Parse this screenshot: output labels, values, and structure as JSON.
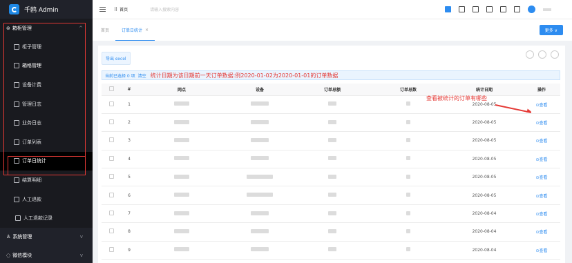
{
  "app": {
    "title": "千鸥 Admin"
  },
  "sidebar": {
    "groups": [
      {
        "label": "箱柜管理",
        "expanded": true
      },
      {
        "label": "系统管理",
        "expanded": false
      },
      {
        "label": "微信模块",
        "expanded": false
      }
    ],
    "items": [
      {
        "label": "柜子管理",
        "icon": "box-icon"
      },
      {
        "label": "箱格管理",
        "icon": "grid-icon"
      },
      {
        "label": "设备计费",
        "icon": "billing-icon"
      },
      {
        "label": "管理日志",
        "icon": "log-icon"
      },
      {
        "label": "业务日志",
        "icon": "log-icon"
      },
      {
        "label": "订单列表",
        "icon": "list-icon"
      },
      {
        "label": "订单日统计",
        "icon": "stats-icon",
        "active": true
      },
      {
        "label": "结算明细",
        "icon": "settle-icon"
      },
      {
        "label": "人工退款",
        "icon": "refund-icon"
      },
      {
        "label": "人工退款记录",
        "icon": "record-icon"
      }
    ]
  },
  "header": {
    "home_label": "首页",
    "search_placeholder": "请输入搜索内容"
  },
  "tabs": {
    "home": "首页",
    "active": "订单日统计",
    "close": "×",
    "more": "更多 ∨"
  },
  "toolbar": {
    "export": "导出 excel"
  },
  "alert": {
    "selected": "当前已选择 0 项",
    "clear": "清空",
    "note": "统计日期为该日期前一天订单数据:例2020-01-02为2020-01-01的订单数据"
  },
  "annotation": "查看被统计的订单有哪些",
  "table": {
    "headers": [
      "#",
      "网点",
      "设备",
      "订单总额",
      "订单总数",
      "统计日期",
      "操作"
    ],
    "rows": [
      {
        "no": "1",
        "date": "2020-08-05",
        "action": "⊙查看"
      },
      {
        "no": "2",
        "date": "2020-08-05",
        "action": "⊙查看"
      },
      {
        "no": "3",
        "date": "2020-08-05",
        "action": "⊙查看"
      },
      {
        "no": "4",
        "date": "2020-08-05",
        "action": "⊙查看"
      },
      {
        "no": "5",
        "date": "2020-08-05",
        "action": "⊙查看"
      },
      {
        "no": "6",
        "date": "2020-08-05",
        "action": "⊙查看"
      },
      {
        "no": "7",
        "date": "2020-08-04",
        "action": "⊙查看"
      },
      {
        "no": "8",
        "date": "2020-08-04",
        "action": "⊙查看"
      },
      {
        "no": "9",
        "date": "2020-08-04",
        "action": "⊙查看"
      }
    ]
  },
  "colors": {
    "accent": "#2d8cf0",
    "sidebar_bg": "#20222a",
    "highlight_red": "#e53935"
  }
}
